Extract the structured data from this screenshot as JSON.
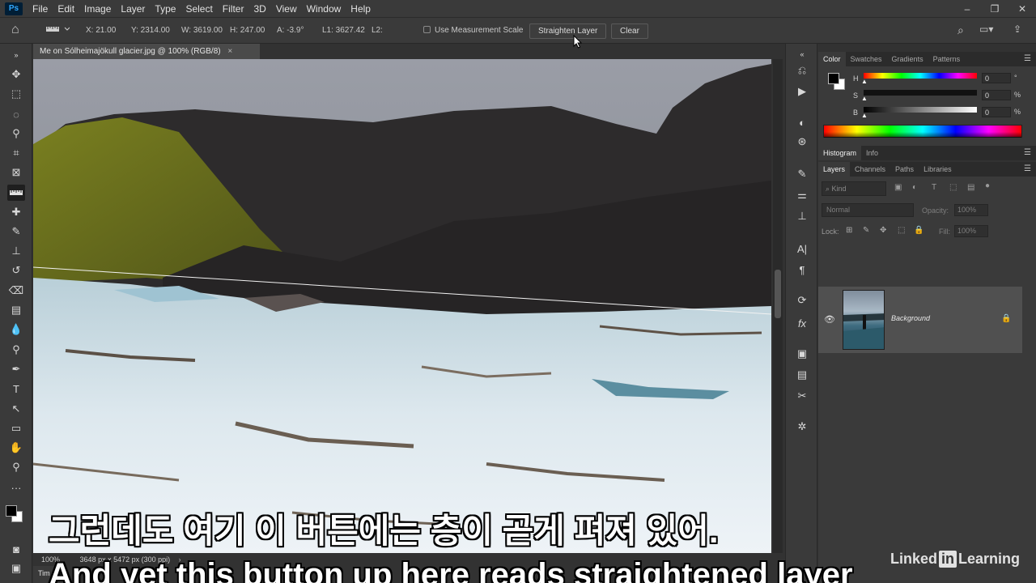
{
  "app": {
    "logo": "Ps"
  },
  "menu": [
    "File",
    "Edit",
    "Image",
    "Layer",
    "Type",
    "Select",
    "Filter",
    "3D",
    "View",
    "Window",
    "Help"
  ],
  "window_controls": [
    "–",
    "❐",
    "✕"
  ],
  "options": {
    "x": "X: 21.00",
    "y": "Y: 2314.00",
    "w": "W: 3619.00",
    "h": "H: 247.00",
    "a": "A: -3.9°",
    "l1": "L1: 3627.42",
    "l2": "L2:",
    "measurement_scale": "Use Measurement Scale",
    "straighten_btn": "Straighten Layer",
    "clear_btn": "Clear"
  },
  "document": {
    "tab_title": "Me on Sólheimajökull glacier.jpg @ 100% (RGB/8)",
    "close": "×",
    "zoom": "100%",
    "status": "3648 px x 5472 px (300 ppi)",
    "timeline_label": "Tim"
  },
  "color_panel": {
    "tabs": [
      "Color",
      "Swatches",
      "Gradients",
      "Patterns"
    ],
    "sliders": [
      {
        "label": "H",
        "value": "0",
        "unit": "°"
      },
      {
        "label": "S",
        "value": "0",
        "unit": "%"
      },
      {
        "label": "B",
        "value": "0",
        "unit": "%"
      }
    ],
    "fg_color": "#000000",
    "bg_color": "#ffffff"
  },
  "histogram_panel": {
    "tabs": [
      "Histogram",
      "Info"
    ]
  },
  "layers_panel": {
    "tabs": [
      "Layers",
      "Channels",
      "Paths",
      "Libraries"
    ],
    "filter_placeholder": "Kind",
    "blend_mode": "Normal",
    "opacity_label": "Opacity:",
    "opacity_value": "100%",
    "lock_label": "Lock:",
    "fill_label": "Fill:",
    "fill_value": "100%",
    "layers": [
      {
        "name": "Background",
        "visible": true,
        "locked": true
      }
    ]
  },
  "subtitles": {
    "korean": "그런데도 여기 이 버튼에는 층이 곧게 펴져 있어.",
    "english": "And yet this button up here reads straightened layer"
  },
  "watermark": {
    "pre": "Linked",
    "in": "in",
    "post": "Learning"
  },
  "colors": {
    "accent": "#31a8ff",
    "panel_bg": "#3a3a3a",
    "dark_bg": "#323232"
  }
}
